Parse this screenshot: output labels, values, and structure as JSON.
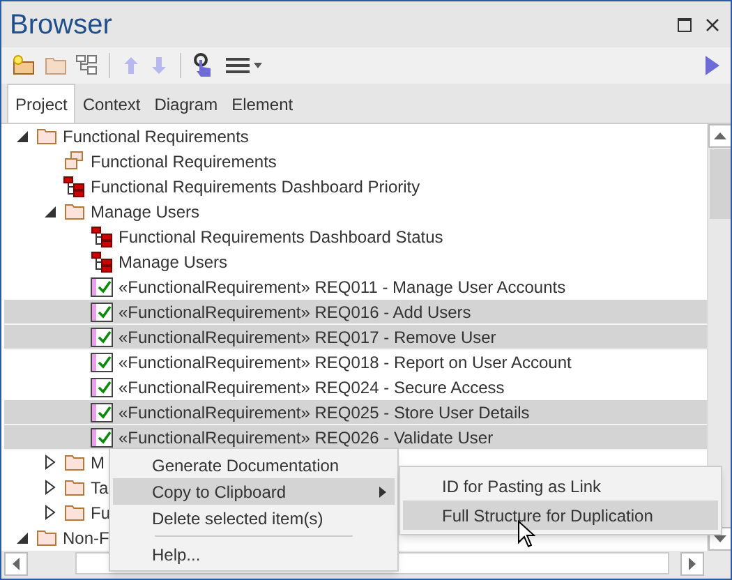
{
  "window": {
    "title": "Browser"
  },
  "tabs": [
    {
      "label": "Project",
      "selected": true
    },
    {
      "label": "Context",
      "selected": false
    },
    {
      "label": "Diagram",
      "selected": false
    },
    {
      "label": "Element",
      "selected": false
    }
  ],
  "tree": [
    {
      "label": "Functional Requirements",
      "kind": "folder",
      "expanded": true,
      "selected": false,
      "children": [
        {
          "label": "Functional Requirements",
          "kind": "package",
          "selected": false
        },
        {
          "label": "Functional Requirements Dashboard Priority",
          "kind": "diagram",
          "selected": false
        },
        {
          "label": "Manage Users",
          "kind": "folder",
          "expanded": true,
          "selected": false,
          "children": [
            {
              "label": "Functional Requirements Dashboard Status",
              "kind": "diagram",
              "selected": false
            },
            {
              "label": "Manage Users",
              "kind": "diagram",
              "selected": false
            },
            {
              "label": "«FunctionalRequirement» REQ011 - Manage User Accounts",
              "kind": "requirement",
              "selected": false
            },
            {
              "label": "«FunctionalRequirement» REQ016 - Add Users",
              "kind": "requirement",
              "selected": true
            },
            {
              "label": "«FunctionalRequirement» REQ017 - Remove User",
              "kind": "requirement",
              "selected": true
            },
            {
              "label": "«FunctionalRequirement» REQ018 - Report on User Account",
              "kind": "requirement",
              "selected": false
            },
            {
              "label": "«FunctionalRequirement» REQ024 - Secure Access",
              "kind": "requirement",
              "selected": false
            },
            {
              "label": "«FunctionalRequirement» REQ025 - Store User Details",
              "kind": "requirement",
              "selected": true
            },
            {
              "label": "«FunctionalRequirement» REQ026 - Validate User",
              "kind": "requirement",
              "selected": true
            }
          ]
        },
        {
          "label": "M",
          "kind": "folder",
          "expanded": false,
          "selected": false
        },
        {
          "label": "Ta",
          "kind": "folder",
          "expanded": false,
          "selected": false
        },
        {
          "label": "Fu",
          "kind": "folder",
          "expanded": false,
          "selected": false
        }
      ]
    },
    {
      "label": "Non-F",
      "kind": "folder",
      "expanded": true,
      "selected": false
    }
  ],
  "context_menu": {
    "items": [
      {
        "label": "Generate Documentation",
        "kind": "item",
        "selected": false
      },
      {
        "label": "Copy to Clipboard",
        "kind": "submenu",
        "selected": true
      },
      {
        "label": "Delete selected item(s)",
        "kind": "item",
        "selected": false
      },
      {
        "kind": "separator"
      },
      {
        "label": "Help...",
        "kind": "item",
        "selected": false
      }
    ]
  },
  "submenu": {
    "items": [
      {
        "label": "ID for Pasting as Link",
        "selected": false
      },
      {
        "label": "Full Structure for Duplication",
        "selected": true
      }
    ]
  }
}
